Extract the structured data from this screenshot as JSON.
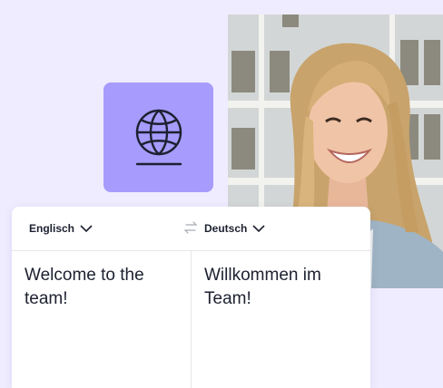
{
  "colors": {
    "background": "#efecff",
    "globe_tile": "#a79bfd",
    "globe_icon": "#1d2130",
    "card": "#ffffff",
    "text": "#1d2130"
  },
  "icons": {
    "hero": "globe-icon",
    "swap": "swap-arrows-icon",
    "dropdown": "chevron-down-icon"
  },
  "translator": {
    "source_language": "Englisch",
    "target_language": "Deutsch",
    "source_text": "Welcome to the team!",
    "target_text": "Willkommen im Team!"
  }
}
